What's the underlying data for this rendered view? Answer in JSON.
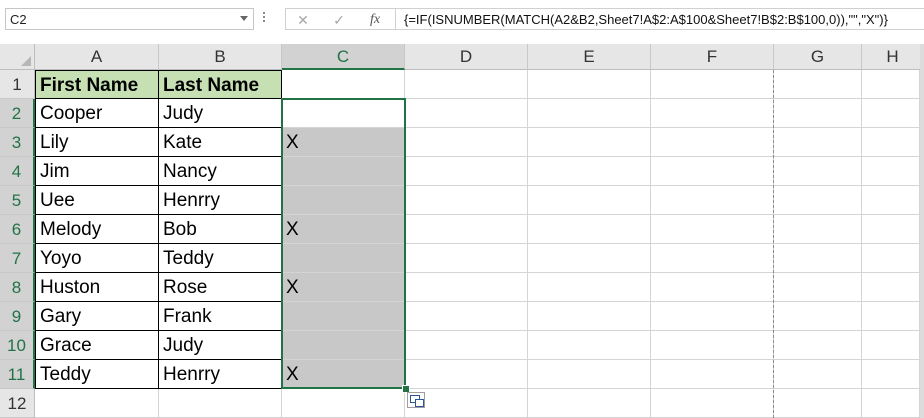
{
  "formula_bar": {
    "name_box": "C2",
    "cancel_icon": "x-icon",
    "enter_icon": "check-icon",
    "fx_label": "fx",
    "formula": "{=IF(ISNUMBER(MATCH(A2&B2,Sheet7!A$2:A$100&Sheet7!B$2:B$100,0)),\"\",\"X\")}"
  },
  "columns": [
    "A",
    "B",
    "C",
    "D",
    "E",
    "F",
    "G",
    "H"
  ],
  "selected_column": "C",
  "rows": [
    {
      "num": "1",
      "a": "First Name",
      "b": "Last Name",
      "c": ""
    },
    {
      "num": "2",
      "a": "Cooper",
      "b": "Judy",
      "c": ""
    },
    {
      "num": "3",
      "a": "Lily",
      "b": "Kate",
      "c": "X"
    },
    {
      "num": "4",
      "a": "Jim",
      "b": "Nancy",
      "c": ""
    },
    {
      "num": "5",
      "a": "Uee",
      "b": "Henrry",
      "c": ""
    },
    {
      "num": "6",
      "a": "Melody",
      "b": "Bob",
      "c": "X"
    },
    {
      "num": "7",
      "a": "Yoyo",
      "b": "Teddy",
      "c": ""
    },
    {
      "num": "8",
      "a": "Huston",
      "b": "Rose",
      "c": "X"
    },
    {
      "num": "9",
      "a": "Gary",
      "b": "Frank",
      "c": ""
    },
    {
      "num": "10",
      "a": "Grace",
      "b": "Judy",
      "c": ""
    },
    {
      "num": "11",
      "a": "Teddy",
      "b": "Henrry",
      "c": "X"
    },
    {
      "num": "12",
      "a": "",
      "b": "",
      "c": ""
    }
  ],
  "colors": {
    "header_fill": "#c6e0b4",
    "selection_accent": "#217346",
    "shaded_cells": "#c8c8c8"
  },
  "quick_analysis_icon": "quick-analysis-icon"
}
